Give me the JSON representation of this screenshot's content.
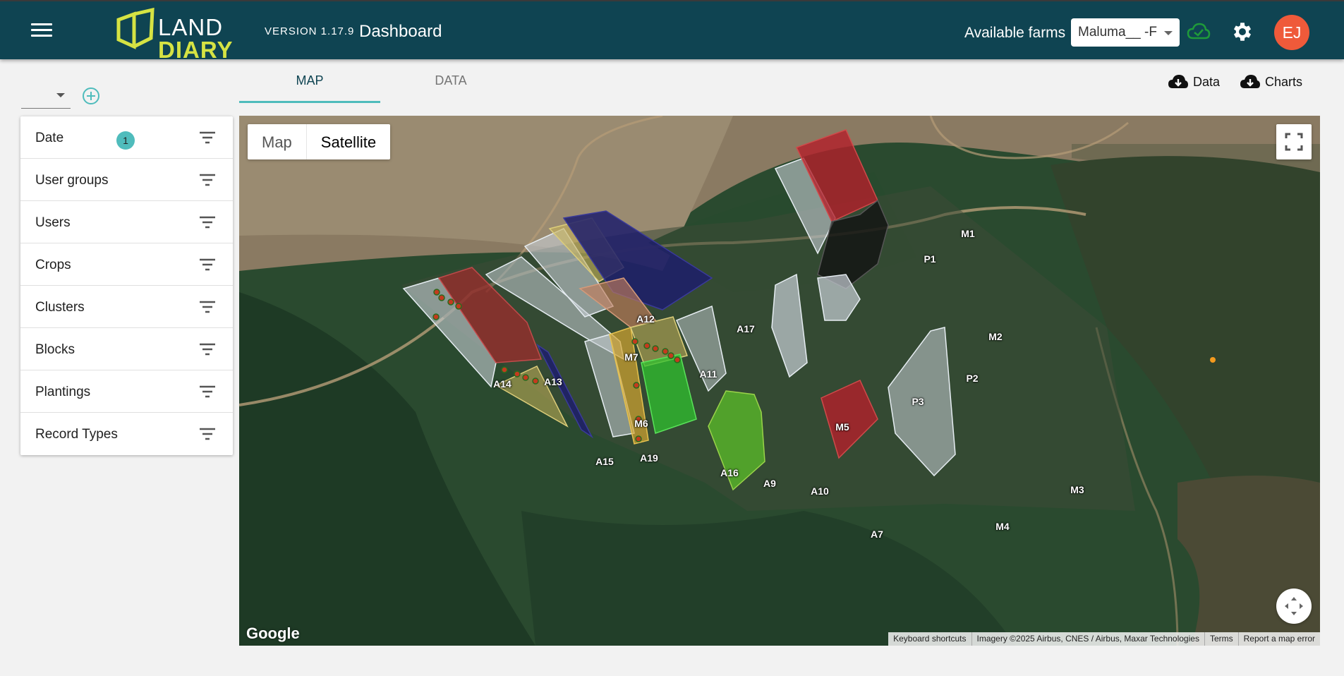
{
  "header": {
    "logo_top": "LAND",
    "logo_bottom": "DIARY",
    "version": "VERSION 1.17.9",
    "title": "Dashboard",
    "farms_label": "Available farms",
    "farm_selected": "Maluma__ -F",
    "avatar_initials": "EJ",
    "sync_status_icon": "cloud-check-icon",
    "accent_color": "#0f4452",
    "brand_yellow": "#d6e343"
  },
  "filters": [
    {
      "label": "Date",
      "badge": "1"
    },
    {
      "label": "User groups"
    },
    {
      "label": "Users"
    },
    {
      "label": "Crops"
    },
    {
      "label": "Clusters"
    },
    {
      "label": "Blocks"
    },
    {
      "label": "Plantings"
    },
    {
      "label": "Record Types"
    }
  ],
  "tabs": {
    "map": "MAP",
    "data": "DATA"
  },
  "downloads": {
    "data": "Data",
    "charts": "Charts"
  },
  "map": {
    "type_map": "Map",
    "type_satellite": "Satellite",
    "google": "Google",
    "attribution": {
      "shortcuts": "Keyboard shortcuts",
      "imagery": "Imagery ©2025 Airbus, CNES / Airbus, Maxar Technologies",
      "terms": "Terms",
      "report": "Report a map error"
    },
    "blocks": [
      "M1",
      "P1",
      "M2",
      "P2",
      "P3",
      "M3",
      "M4",
      "M5",
      "M6",
      "M7",
      "A7",
      "A9",
      "A10",
      "A11",
      "A12",
      "A13",
      "A14",
      "A15",
      "A16",
      "A17",
      "A19"
    ]
  }
}
